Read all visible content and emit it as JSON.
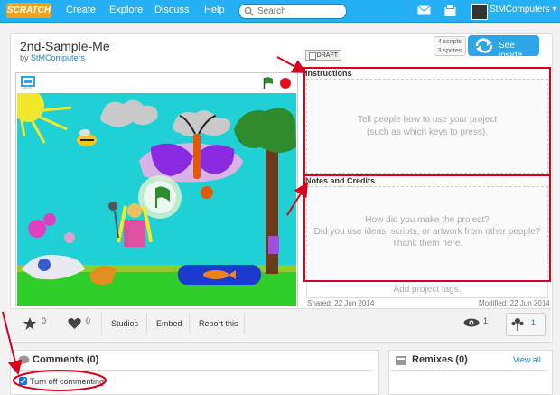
{
  "topbar": {
    "logo": "SCRATCH",
    "nav": [
      "Create",
      "Explore",
      "Discuss",
      "Help"
    ],
    "search_placeholder": "Search",
    "username": "StMComputers ▾"
  },
  "project": {
    "title": "2nd-Sample-Me",
    "by_label": "by",
    "author": "StMComputers",
    "draft_label": "DRAFT",
    "scripts_count": "4 scripts",
    "sprites_count": "3 sprites",
    "see_inside_label": "See inside",
    "stage_size_label": "+420"
  },
  "instructions": {
    "label": "Instructions",
    "placeholder_line1": "Tell people how to use your project",
    "placeholder_line2": "(such as which keys to press)."
  },
  "notes": {
    "label": "Notes and Credits",
    "placeholder_line1": "How did you make the project?",
    "placeholder_line2": "Did you use ideas, scripts, or artwork from other people?",
    "placeholder_line3": "Thank them here."
  },
  "tags_placeholder": "Add project tags.",
  "shared": "Shared: 22 Jun 2014",
  "modified": "Modified: 22 Jun 2014",
  "stats": {
    "favorites": "0",
    "loves": "0",
    "studios_label": "Studios",
    "embed_label": "Embed",
    "report_label": "Report this",
    "views": "1",
    "remix_count": "1"
  },
  "comments": {
    "title": "Comments (0)",
    "turn_off_label": "Turn off commenting",
    "turn_off_checked": true
  },
  "remixes": {
    "title": "Remixes (0)",
    "view_all": "View all"
  },
  "colors": {
    "topbar": "#25aff4",
    "see_inside": "#2ca6e6",
    "annotation": "#d9001b",
    "link": "#1a86c6"
  }
}
